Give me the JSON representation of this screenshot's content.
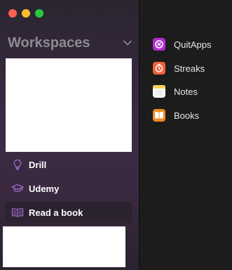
{
  "window": {
    "controls": [
      "close",
      "minimize",
      "maximize"
    ]
  },
  "sidebar": {
    "title": "Workspaces",
    "items": [
      {
        "label": "Drill",
        "icon": "lightbulb-icon"
      },
      {
        "label": "Udemy",
        "icon": "graduation-cap-icon"
      },
      {
        "label": "Read a book",
        "icon": "open-book-icon",
        "selected": true
      }
    ]
  },
  "apps": [
    {
      "label": "QuitApps",
      "icon": "quitapps-icon",
      "color": "#b32ccf"
    },
    {
      "label": "Streaks",
      "icon": "streaks-icon",
      "color": "#f0623a"
    },
    {
      "label": "Notes",
      "icon": "notes-icon",
      "color": "#f4d35e"
    },
    {
      "label": "Books",
      "icon": "books-icon",
      "color": "#f08a24"
    }
  ],
  "colors": {
    "accent": "#9b6bc8",
    "sidebar_text": "#ffffff",
    "title_text": "#8e8a93"
  }
}
